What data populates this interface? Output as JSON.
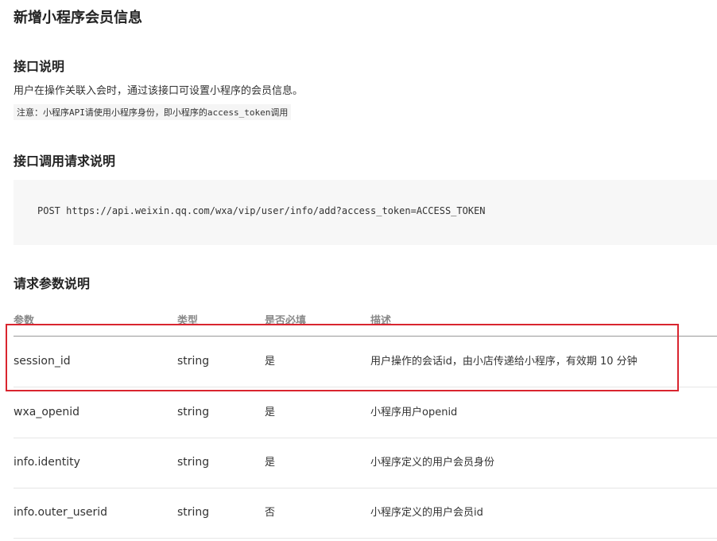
{
  "page": {
    "title": "新增小程序会员信息"
  },
  "interface_desc": {
    "heading": "接口说明",
    "text": "用户在操作关联入会时，通过该接口可设置小程序的会员信息。",
    "note": "注意：小程序API请使用小程序身份，即小程序的access_token调用"
  },
  "request": {
    "heading": "接口调用请求说明",
    "code": "POST https://api.weixin.qq.com/wxa/vip/user/info/add?access_token=ACCESS_TOKEN"
  },
  "params": {
    "heading": "请求参数说明",
    "columns": [
      "参数",
      "类型",
      "是否必填",
      "描述"
    ],
    "rows": [
      {
        "name": "session_id",
        "type": "string",
        "required": "是",
        "desc": "用户操作的会话id，由小店传递给小程序，有效期 10 分钟"
      },
      {
        "name": "wxa_openid",
        "type": "string",
        "required": "是",
        "desc": "小程序用户openid"
      },
      {
        "name": "info.identity",
        "type": "string",
        "required": "是",
        "desc": "小程序定义的用户会员身份"
      },
      {
        "name": "info.outer_userid",
        "type": "string",
        "required": "否",
        "desc": "小程序定义的用户会员id"
      }
    ]
  },
  "annotation": {
    "highlight_color": "#d9252f",
    "highlighted_row": "session_id"
  }
}
